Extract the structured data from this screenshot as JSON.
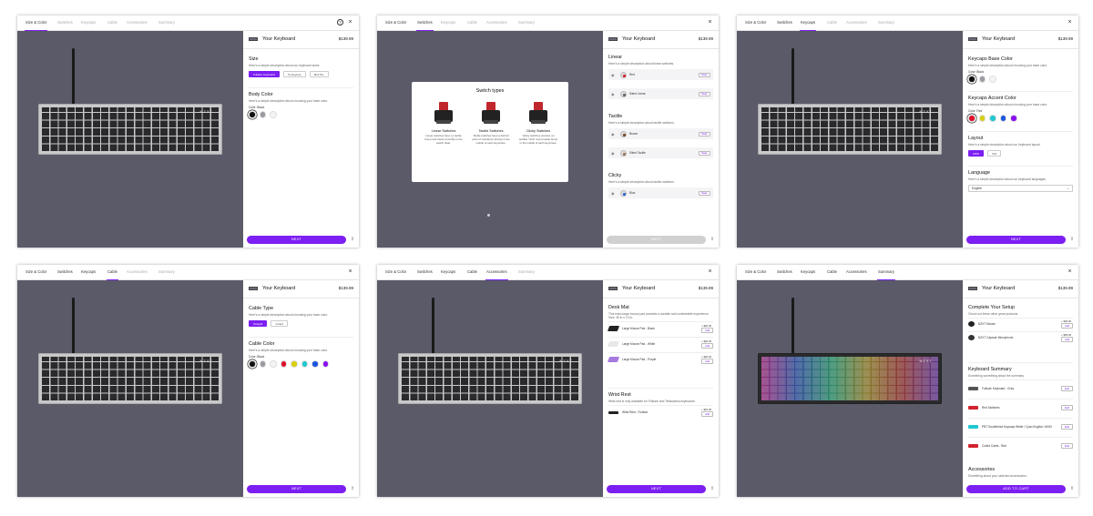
{
  "common": {
    "sidebar_title": "Your Keyboard",
    "price": "$139.99",
    "tabs": [
      "Size & Color",
      "Switches",
      "Keycaps",
      "Cable",
      "Accessories",
      "Summary"
    ],
    "close_icon": "×",
    "share_icon": "⇪",
    "brand": "NZXT"
  },
  "panel1": {
    "active_tab": 0,
    "size": {
      "title": "Size",
      "desc": "Here's a simple description about our keyboard sizes.",
      "options": [
        "Fullsize Keyboard",
        "Tenkeyless",
        "MiniTKL"
      ]
    },
    "body_color": {
      "title": "Body Color",
      "desc": "Here's a simple description about choosing your base color.",
      "label": "Color: Black",
      "swatches": [
        "#111111",
        "#9a9aa0",
        "#f4f4f4"
      ]
    },
    "next": "NEXT"
  },
  "panel2": {
    "active_tab": 1,
    "modal": {
      "title": "Switch types",
      "columns": [
        {
          "name": "Linear Switches",
          "desc": "Linear switches have no tactile bump and travel smoothly to the switch plate."
        },
        {
          "name": "Tactile Switches",
          "desc": "Tactile switches have a distinct point of resistance (bump) in the middle of each keystroke."
        },
        {
          "name": "Clicky Switches",
          "desc": "Clicky switches produce an audible \"click\" and a tactile bump in the middle of each keystroke."
        }
      ]
    },
    "linear": {
      "title": "Linear",
      "desc": "Here's a simple description about linear switches.",
      "items": [
        {
          "name": "Red",
          "color": "#d2222d"
        },
        {
          "name": "Silent Linear",
          "color": "#666666"
        }
      ]
    },
    "tactile": {
      "title": "Tactile",
      "desc": "Here's a simple description about tactile switches.",
      "items": [
        {
          "name": "Brown",
          "color": "#7a4a2a"
        },
        {
          "name": "Silent Tactile",
          "color": "#a0785a"
        }
      ]
    },
    "clicky": {
      "title": "Clicky",
      "desc": "Here's a simple description about tactile switches.",
      "items": [
        {
          "name": "Blue",
          "color": "#2a6ad2"
        }
      ]
    },
    "swap_label": "Swap",
    "next": "NEXT"
  },
  "panel3": {
    "active_tab": 2,
    "base": {
      "title": "Keycaps Base Color",
      "desc": "Here's a simple description about choosing your base color.",
      "label": "Color: Black",
      "swatches": [
        "#111111",
        "#9a9aa0",
        "#f4f4f4"
      ]
    },
    "accent": {
      "title": "Keycaps Accent Color",
      "desc": "Here's a simple description about choosing your base color.",
      "label": "Color: Red",
      "swatches": [
        "#e0102a",
        "#d8d010",
        "#20c8d0",
        "#1a56e0",
        "#8a10f0"
      ]
    },
    "layout": {
      "title": "Layout",
      "desc": "Here's a simple description about our keyboard layout.",
      "options": [
        "ANSI",
        "ISO"
      ]
    },
    "language": {
      "title": "Language",
      "desc": "Here's a simple description about our keyboard languages.",
      "value": "English"
    },
    "next": "NEXT"
  },
  "panel4": {
    "active_tab": 3,
    "type": {
      "title": "Cable Type",
      "desc": "Here's a simple description about choosing your base color.",
      "options": [
        "Straight",
        "Coiled"
      ]
    },
    "color": {
      "title": "Cable Color",
      "desc": "Here's a simple description about choosing your base color.",
      "label": "Color: Black",
      "swatches": [
        "#111111",
        "#9a9aa0",
        "#f4f4f4",
        "#e0102a",
        "#d8d010",
        "#20c8d0",
        "#1a56e0",
        "#8a10f0"
      ]
    },
    "next": "NEXT"
  },
  "panel5": {
    "active_tab": 4,
    "desk": {
      "title": "Desk Mat",
      "desc": "This extra large mouse pad provides a durable and comfortable experience. Size: 35 in x 13 in.",
      "items": [
        {
          "name": "Large Mouse Pad - Black",
          "price": "+ $20.00",
          "color": "#222222"
        },
        {
          "name": "Large Mouse Pad - White",
          "price": "+ $20.00",
          "color": "#e8e8e8"
        },
        {
          "name": "Large Mouse Pad - Purple",
          "price": "+ $20.00",
          "color": "#a57be0"
        }
      ]
    },
    "wrist": {
      "title": "Wrist Rest",
      "desc": "Wrist rest is only available for Fullsize and Tenkeyless keyboards.",
      "items": [
        {
          "name": "Wrist Rest - Fullsize",
          "price": "+ $15.00",
          "color": "#222222"
        }
      ]
    },
    "add_label": "Add",
    "next": "NEXT"
  },
  "panel6": {
    "active_tab": 5,
    "setup": {
      "title": "Complete Your Setup",
      "desc": "Check out these other great products.",
      "items": [
        {
          "name": "NZXT Mouse",
          "price": "+ $39.00",
          "color": "#222222"
        },
        {
          "name": "NZXT Capsule Microphone",
          "price": "+ $59.00",
          "color": "#333333"
        }
      ]
    },
    "summary": {
      "title": "Keyboard Summary",
      "desc": "Something something about the summary.",
      "items": [
        {
          "name": "Fullsize Keyboard - Grey",
          "color": "#555555"
        },
        {
          "name": "Red Switches",
          "color": "#d2222d"
        },
        {
          "name": "PBT Doubleshot Keycaps White / Cyan English / ANSI",
          "color": "#20c8d0"
        },
        {
          "name": "Coiled Cable - Red",
          "color": "#d2222d"
        }
      ]
    },
    "accessories": {
      "title": "Accessories",
      "desc": "Something about your selected accessories."
    },
    "add_label": "Add",
    "edit_label": "Edit",
    "cta": "ADD TO CART"
  }
}
